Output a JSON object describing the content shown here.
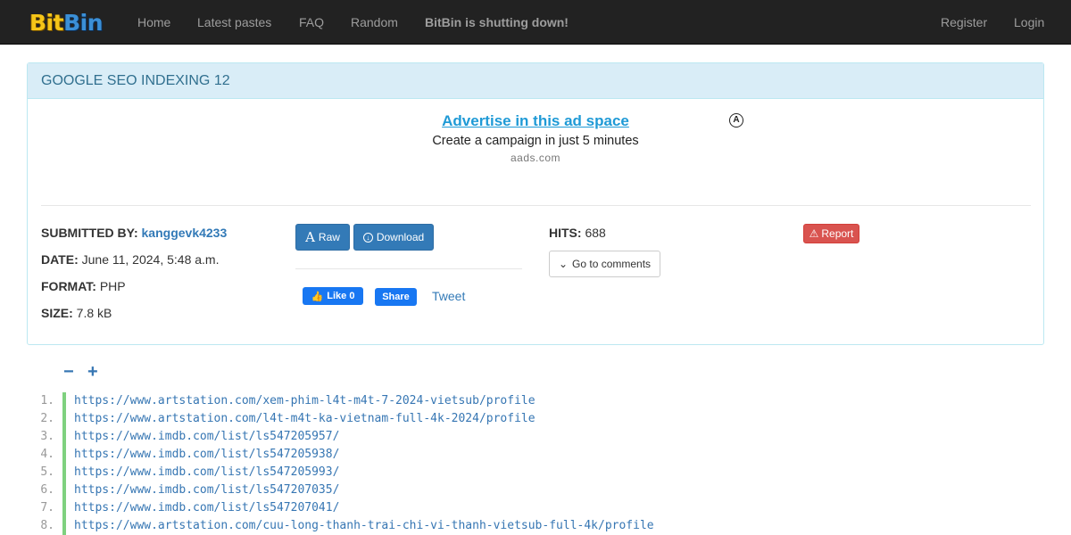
{
  "nav": {
    "brand_part1": "Bit",
    "brand_part2": "Bin",
    "home": "Home",
    "latest": "Latest pastes",
    "faq": "FAQ",
    "random": "Random",
    "notice": "BitBin is shutting down!",
    "register": "Register",
    "login": "Login"
  },
  "paste": {
    "title": "GOOGLE SEO INDEXING 12",
    "submitted_label": "SUBMITTED BY:",
    "submitted_by": "kanggevk4233",
    "date_label": "DATE:",
    "date": "June 11, 2024, 5:48 a.m.",
    "format_label": "FORMAT:",
    "format": "PHP",
    "size_label": "SIZE:",
    "size": "7.8 kB",
    "hits_label": "HITS:",
    "hits": "688"
  },
  "ad": {
    "title": "Advertise in this ad space",
    "subtitle": "Create a campaign in just 5 minutes",
    "domain": "aads.com"
  },
  "buttons": {
    "raw": "Raw",
    "download": "Download",
    "comments": "Go to comments",
    "report": "Report"
  },
  "social": {
    "like": "Like 0",
    "share": "Share",
    "tweet": "Tweet"
  },
  "zoom": {
    "minus": "−",
    "plus": "+"
  },
  "code_lines": [
    {
      "n": "1.",
      "text": "https://www.artstation.com/xem-phim-l4t-m4t-7-2024-vietsub/profile"
    },
    {
      "n": "2.",
      "text": "https://www.artstation.com/l4t-m4t-ka-vietnam-full-4k-2024/profile"
    },
    {
      "n": "3.",
      "text": "https://www.imdb.com/list/ls547205957/"
    },
    {
      "n": "4.",
      "text": "https://www.imdb.com/list/ls547205938/"
    },
    {
      "n": "5.",
      "text": "https://www.imdb.com/list/ls547205993/"
    },
    {
      "n": "6.",
      "text": "https://www.imdb.com/list/ls547207035/"
    },
    {
      "n": "7.",
      "text": "https://www.imdb.com/list/ls547207041/"
    },
    {
      "n": "8.",
      "text": "https://www.artstation.com/cuu-long-thanh-trai-chi-vi-thanh-vietsub-full-4k/profile"
    }
  ],
  "colors": {
    "navbar": "#222222",
    "heading_bg": "#d9edf7",
    "link": "#337ab7",
    "danger": "#d9534f",
    "line_bar": "#7fd17f"
  }
}
